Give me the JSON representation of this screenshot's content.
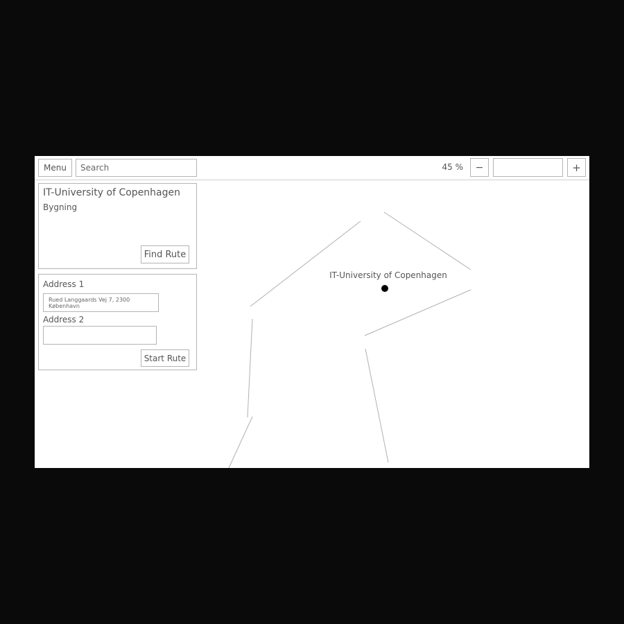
{
  "toolbar": {
    "menu_label": "Menu",
    "search_placeholder": "Search",
    "zoom_level": "45 %",
    "zoom_out_label": "−",
    "zoom_in_label": "+",
    "zoom_input_value": ""
  },
  "info_panel": {
    "title": "IT-University of Copenhagen",
    "subtitle": "Bygning",
    "find_route_label": "Find Rute"
  },
  "route_panel": {
    "address1_label": "Address 1",
    "address1_value": "Rued Langgaards Vej 7, 2300 København",
    "address2_label": "Address 2",
    "address2_value": "",
    "start_route_label": "Start Rute"
  },
  "map": {
    "marker_label": "IT-University of Copenhagen",
    "line_color": "#b0b0b0",
    "marker_color": "#000000"
  }
}
